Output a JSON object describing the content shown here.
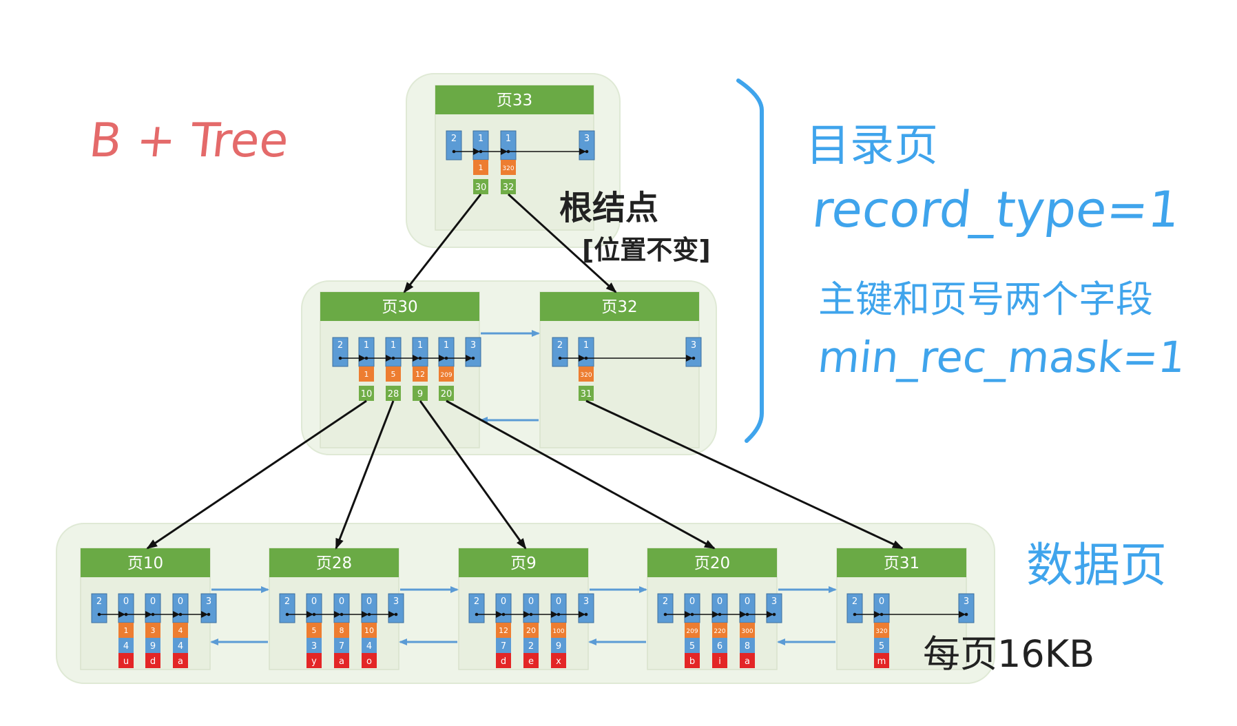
{
  "notes": {
    "title": "B + Tree",
    "directory_pages": "目录页",
    "record_type": "record_type=1",
    "fields": "主键和页号两个字段",
    "min_rec_mask": "min_rec_mask=1",
    "root_node": "根结点",
    "position_fixed": "[位置不变]",
    "data_pages": "数据页",
    "page_size": "每页16KB"
  },
  "colors": {
    "header_green": "#6aaa45",
    "key_green": "#70ad47",
    "blue": "#5b9bd5",
    "orange": "#ed7d31",
    "red": "#e32626",
    "level_bg": "#eef4e8",
    "page_bg": "#e8efdf",
    "link_blue": "#5b9bd5",
    "bracket_blue": "#3fa4ec",
    "note_red": "#e46a6a"
  },
  "pages": [
    {
      "id": "p33",
      "title": "页33",
      "records": [
        {
          "type": "2"
        },
        {
          "type": "1",
          "id": "1",
          "key": "30"
        },
        {
          "type": "1",
          "id": "320",
          "key": "32"
        },
        {
          "type": "3"
        }
      ]
    },
    {
      "id": "p30",
      "title": "页30",
      "records": [
        {
          "type": "2"
        },
        {
          "type": "1",
          "id": "1",
          "key": "10"
        },
        {
          "type": "1",
          "id": "5",
          "key": "28"
        },
        {
          "type": "1",
          "id": "12",
          "key": "9"
        },
        {
          "type": "1",
          "id": "209",
          "key": "20"
        },
        {
          "type": "3"
        }
      ]
    },
    {
      "id": "p32",
      "title": "页32",
      "records": [
        {
          "type": "2"
        },
        {
          "type": "1",
          "id": "320",
          "key": "31"
        },
        {
          "type": "3"
        }
      ]
    },
    {
      "id": "p10",
      "title": "页10",
      "records": [
        {
          "type": "2"
        },
        {
          "type": "0",
          "id": "1",
          "num": "4",
          "ch": "u"
        },
        {
          "type": "0",
          "id": "3",
          "num": "9",
          "ch": "d"
        },
        {
          "type": "0",
          "id": "4",
          "num": "4",
          "ch": "a"
        },
        {
          "type": "3"
        }
      ]
    },
    {
      "id": "p28",
      "title": "页28",
      "records": [
        {
          "type": "2"
        },
        {
          "type": "0",
          "id": "5",
          "num": "3",
          "ch": "y"
        },
        {
          "type": "0",
          "id": "8",
          "num": "7",
          "ch": "a"
        },
        {
          "type": "0",
          "id": "10",
          "num": "4",
          "ch": "o"
        },
        {
          "type": "3"
        }
      ]
    },
    {
      "id": "p9",
      "title": "页9",
      "records": [
        {
          "type": "2"
        },
        {
          "type": "0",
          "id": "12",
          "num": "7",
          "ch": "d"
        },
        {
          "type": "0",
          "id": "20",
          "num": "2",
          "ch": "e"
        },
        {
          "type": "0",
          "id": "100",
          "num": "9",
          "ch": "x"
        },
        {
          "type": "3"
        }
      ]
    },
    {
      "id": "p20",
      "title": "页20",
      "records": [
        {
          "type": "2"
        },
        {
          "type": "0",
          "id": "209",
          "num": "5",
          "ch": "b"
        },
        {
          "type": "0",
          "id": "220",
          "num": "6",
          "ch": "i"
        },
        {
          "type": "0",
          "id": "300",
          "num": "8",
          "ch": "a"
        },
        {
          "type": "3"
        }
      ]
    },
    {
      "id": "p31",
      "title": "页31",
      "records": [
        {
          "type": "2"
        },
        {
          "type": "0",
          "id": "320",
          "num": "5",
          "ch": "m"
        },
        {
          "type": "3"
        }
      ]
    }
  ]
}
